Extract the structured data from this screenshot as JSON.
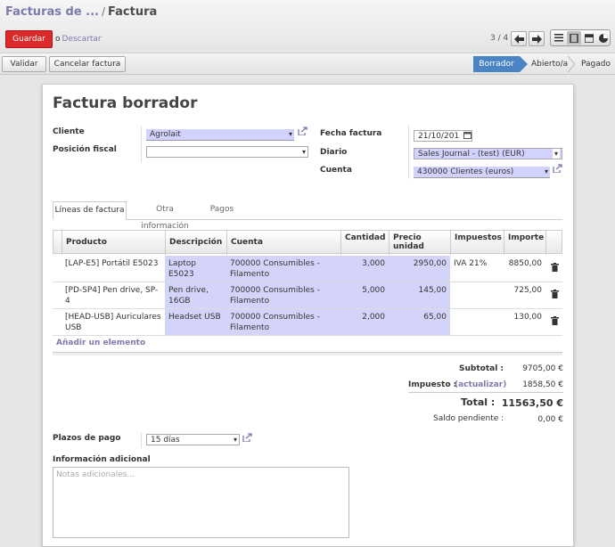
{
  "breadcrumb": {
    "parent": "Facturas de ...",
    "separator": "/",
    "current": "Factura"
  },
  "toolbar": {
    "save_label": "Guardar",
    "discard_prefix": "o",
    "discard_label": "Descartar",
    "pager": "3 / 4"
  },
  "statusbar": {
    "buttons": [
      "Validar",
      "Cancelar factura"
    ],
    "stages": [
      "Borrador",
      "Abierto/a",
      "Pagado"
    ]
  },
  "form": {
    "title": "Factura borrador",
    "cliente_label": "Cliente",
    "cliente_value": "Agrolait",
    "posicion_label": "Posición fiscal",
    "posicion_value": "",
    "fecha_label": "Fecha factura",
    "fecha_value": "21/10/201",
    "diario_label": "Diario",
    "diario_value": "Sales Journal - (test) (EUR)",
    "cuenta_label": "Cuenta",
    "cuenta_value": "430000 Clientes (euros)"
  },
  "tabs": [
    "Líneas de factura",
    "Otra información",
    "Pagos"
  ],
  "table": {
    "headers": [
      "Producto",
      "Descripción",
      "Cuenta",
      "Cantidad",
      "Precio unidad",
      "Impuestos",
      "Importe"
    ],
    "rows": [
      {
        "producto": "[LAP-E5] Portátil E5023",
        "descripcion": "Laptop E5023",
        "cuenta": "700000 Consumibles - Filamento",
        "cantidad": "3,000",
        "precio": "2950,00",
        "impuestos": "IVA 21%",
        "importe": "8850,00"
      },
      {
        "producto": "[PD-SP4] Pen drive, SP-4",
        "descripcion": "Pen drive, 16GB",
        "cuenta": "700000 Consumibles - Filamento",
        "cantidad": "5,000",
        "precio": "145,00",
        "impuestos": "",
        "importe": "725,00"
      },
      {
        "producto": "[HEAD-USB] Auriculares USB",
        "descripcion": "Headset USB",
        "cuenta": "700000 Consumibles - Filamento",
        "cantidad": "2,000",
        "precio": "65,00",
        "impuestos": "",
        "importe": "130,00"
      }
    ],
    "add_label": "Añadir un elemento"
  },
  "totals": {
    "subtotal_label": "Subtotal :",
    "subtotal_value": "9705,00 €",
    "impuesto_label": "Impuesto :",
    "actualizar_label": "(actualizar)",
    "impuesto_value": "1858,50 €",
    "total_label": "Total :",
    "total_value": "11563,50 €",
    "saldo_label": "Saldo pendiente :",
    "saldo_value": "0,00 €"
  },
  "plazos": {
    "label": "Plazos de pago",
    "value": "15 días"
  },
  "info": {
    "label": "Información adicional",
    "placeholder": "Notas adicionales..."
  },
  "colors": {
    "accent": "#7c7bad",
    "save": "#dc2a2a",
    "stage_active": "#4a84c4",
    "required_field": "#d2d2ff"
  }
}
